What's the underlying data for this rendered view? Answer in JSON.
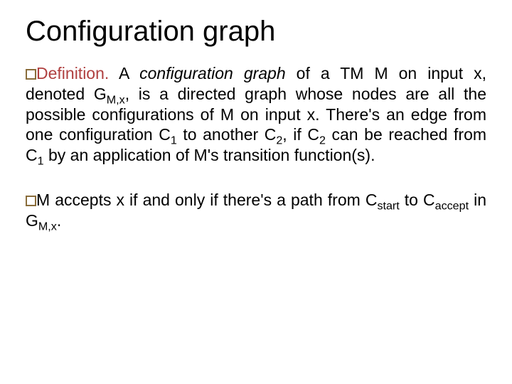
{
  "title": "Configuration graph",
  "p1": {
    "def_label": "Definition.",
    "lead1": "   A ",
    "config_phrase": "configuration graph",
    "lead2": " of a TM M on input x, denoted G",
    "sub_mx": "M,x",
    "lead3": ", is a directed graph whose nodes are all the possible configurations of M on input x. There's an edge from one configuration C",
    "sub1": "1",
    "lead4": " to another C",
    "sub2": "2",
    "lead5": ", if C",
    "sub2b": "2",
    "lead6": " can be reached from C",
    "sub1b": "1",
    "lead7": " by an application of M's transition function(s)."
  },
  "p2": {
    "t1": "M accepts x if and only if there's a path from C",
    "sub_start": "start",
    "t2": " to C",
    "sub_accept": "accept",
    "t3": " in G",
    "sub_mx": "M,x",
    "t4": "."
  }
}
